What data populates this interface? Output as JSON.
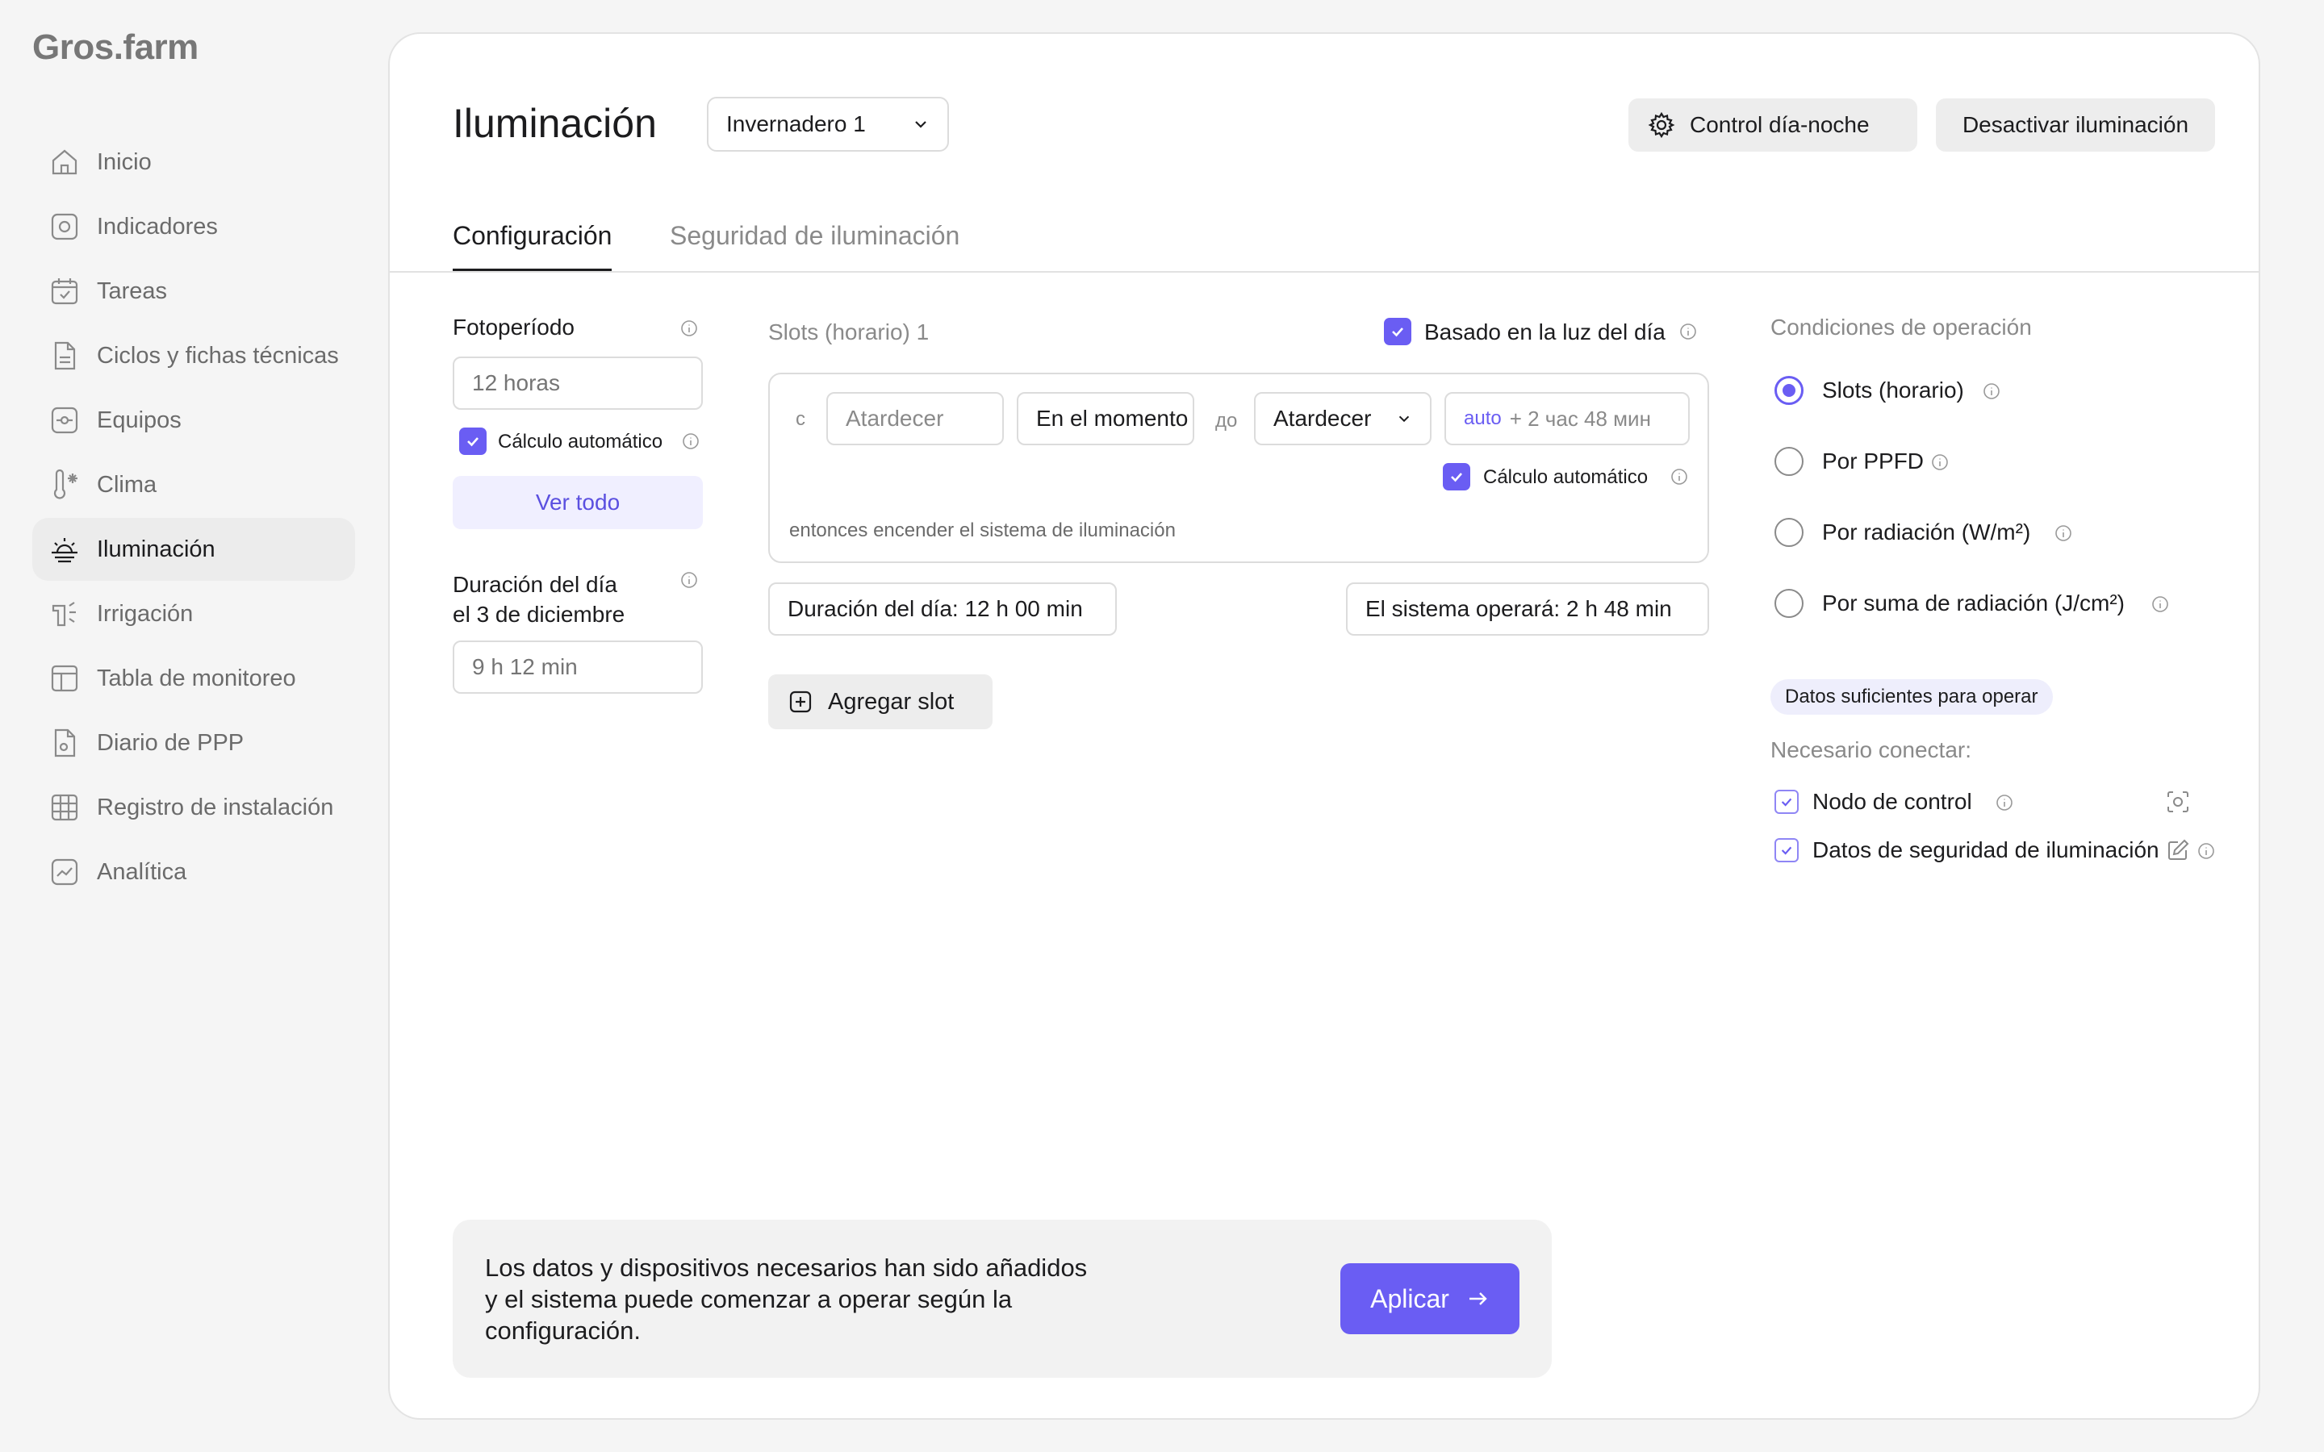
{
  "app": {
    "logo": "Gros.farm"
  },
  "sidebar": {
    "items": [
      {
        "label": "Inicio",
        "icon": "home-icon"
      },
      {
        "label": "Indicadores",
        "icon": "indicators-icon"
      },
      {
        "label": "Tareas",
        "icon": "calendar-icon"
      },
      {
        "label": "Ciclos y fichas técnicas",
        "icon": "document-icon"
      },
      {
        "label": "Equipos",
        "icon": "device-icon"
      },
      {
        "label": "Clima",
        "icon": "thermometer-icon"
      },
      {
        "label": "Iluminación",
        "icon": "sunrise-icon",
        "active": true
      },
      {
        "label": "Irrigación",
        "icon": "sprinkler-icon"
      },
      {
        "label": "Tabla de monitoreo",
        "icon": "table-icon"
      },
      {
        "label": "Diario de PPP",
        "icon": "document-gear-icon"
      },
      {
        "label": "Registro de instalación",
        "icon": "grid-icon"
      },
      {
        "label": "Analítica",
        "icon": "chart-icon"
      }
    ]
  },
  "header": {
    "title": "Iluminación",
    "greenhouse": "Invernadero 1",
    "day_night_button": "Control día-noche",
    "disable_button": "Desactivar iluminación"
  },
  "tabs": [
    {
      "label": "Configuración",
      "active": true
    },
    {
      "label": "Seguridad de iluminación",
      "active": false
    }
  ],
  "photoperiod": {
    "label": "Fotoperíodo",
    "placeholder": "12 horas",
    "auto_calc_label": "Cálculo automático",
    "auto_calc_checked": true,
    "view_all": "Ver todo",
    "day_length_label_line1": "Duración del día",
    "day_length_label_line2": "el 3 de diciembre",
    "day_length_placeholder": "9 h 12 min"
  },
  "slots": {
    "title": "Slots (horario) 1",
    "daylight_based_label": "Basado en la luz del día",
    "daylight_based_checked": true,
    "from_prefix": "с",
    "from_value": "Atardecer",
    "moment": "En el momento",
    "to_prefix": "до",
    "to_value": "Atardecer",
    "duration_auto": "auto",
    "duration_rest": "+ 2 час 48 мин",
    "auto_calc_label": "Cálculo automático",
    "auto_calc_checked": true,
    "then_text": "entonces encender el sistema de iluminación",
    "day_duration": "Duración del día: 12 h 00 min",
    "system_operates": "El sistema operará: 2 h 48 min",
    "add_slot": "Agregar slot"
  },
  "conditions": {
    "title": "Condiciones de operación",
    "options": [
      {
        "label": "Slots (horario)",
        "selected": true
      },
      {
        "label": "Por PPFD",
        "selected": false
      },
      {
        "label": "Por radiación (W/m²)",
        "selected": false
      },
      {
        "label": "Por suma de radiación (J/cm²)",
        "selected": false
      }
    ],
    "badge": "Datos suficientes para operar",
    "need_connect": "Necesario conectar:",
    "requirements": [
      {
        "label": "Nodo de control",
        "checked": true,
        "action_icon": "scan-icon"
      },
      {
        "label": "Datos de seguridad de iluminación",
        "checked": true,
        "action_icon": "edit-icon"
      }
    ]
  },
  "banner": {
    "text_line1": "Los datos y dispositivos necesarios han sido añadidos",
    "text_line2": "y el sistema puede comenzar a operar según la",
    "text_line3": "configuración.",
    "apply": "Aplicar"
  },
  "colors": {
    "accent": "#6a5df3",
    "accent_light": "#f0efff",
    "background": "#f5f5f5",
    "panel": "#ffffff"
  }
}
